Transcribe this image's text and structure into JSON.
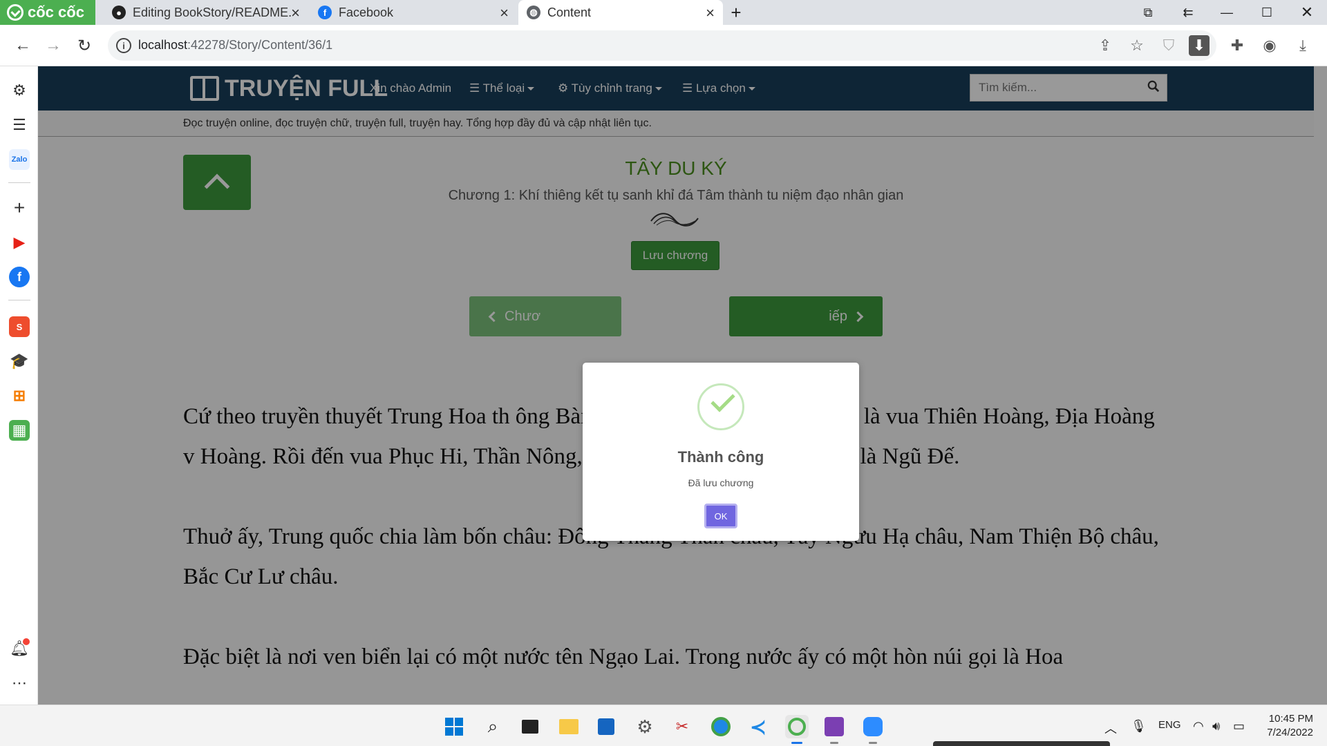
{
  "browser": {
    "brand": "cốc cốc",
    "tabs": [
      {
        "title": "Editing BookStory/README.r",
        "icon": "github-icon"
      },
      {
        "title": "Facebook",
        "icon": "facebook-icon"
      },
      {
        "title": "Content",
        "icon": "globe-icon"
      }
    ],
    "url_host": "localhost",
    "url_path": ":42278/Story/Content/36/1"
  },
  "site": {
    "logo": "TRUYỆN FULL",
    "nav": {
      "greeting": "Xin chào Admin",
      "genres": "Thể loại",
      "customize": "Tùy chỉnh trang",
      "options": "Lựa chọn"
    },
    "search_placeholder": "Tìm kiếm...",
    "tagline": "Đọc truyện online, đọc truyện chữ, truyện full, truyện hay. Tổng hợp đầy đủ và cập nhật liên tục."
  },
  "story": {
    "title": "TÂY DU KÝ",
    "chapter": "Chương 1: Khí thiêng kết tụ sanh khỉ đá Tâm thành tu niệm đạo nhân gian",
    "save_chapter": "Lưu chương",
    "prev_label": "Chươ",
    "next_label": "iếp",
    "paragraphs": [
      "Cứ theo truyền thuyết Trung Hoa th ông Bàn Cổ làm chúa thiên hạ. Kế đó là vua Thiên Hoàng, Địa Hoàng v Hoàng. Rồi đến vua Phục Hi, Thần Nông, Huỳnh, Nghiêu và Thuấn gọi là Ngũ Đế.",
      "Thuở ấy, Trung quốc chia làm bốn châu: Đông Thắng Thần châu, Tây Ngưu Hạ châu, Nam Thiện Bộ châu, Bắc Cư Lư châu.",
      "Đặc biệt là nơi ven biển lại có một nước tên Ngạo Lai. Trong nước ấy có một hòn núi gọi là Hoa"
    ]
  },
  "modal": {
    "title": "Thành công",
    "text": "Đã lưu chương",
    "ok": "OK"
  },
  "taskbar": {
    "lang": "ENG",
    "time": "10:45 PM",
    "date": "7/24/2022"
  },
  "colors": {
    "site_nav": "#183e5a",
    "green": "#3c9a3c",
    "ok_button": "#7066e0",
    "title_green": "#4b8f1f"
  }
}
